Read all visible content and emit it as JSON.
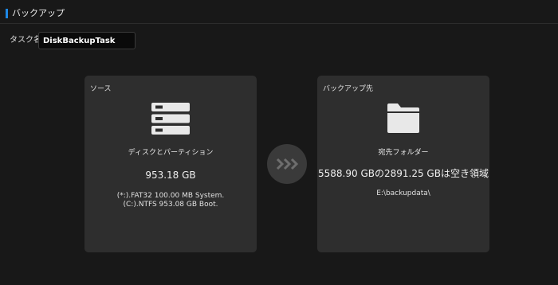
{
  "header": {
    "title": "バックアップ",
    "accent_color": "#1e88e5"
  },
  "task": {
    "label": "タスク名:",
    "value": "DiskBackupTask"
  },
  "source": {
    "title": "ソース",
    "icon": "drive-stack-icon",
    "label": "ディスクとパーティション",
    "size": "953.18 GB",
    "partitions": [
      "(*:).FAT32 100.00 MB System.",
      "(C:).NTFS 953.08 GB Boot."
    ]
  },
  "arrow": {
    "icon": "triple-chevron-right-icon"
  },
  "destination": {
    "title": "バックアップ先",
    "icon": "folder-icon",
    "label": "宛先フォルダー",
    "capacity": "5588.90 GBの2891.25 GBは空き領域",
    "path": "E:\\backupdata\\"
  }
}
